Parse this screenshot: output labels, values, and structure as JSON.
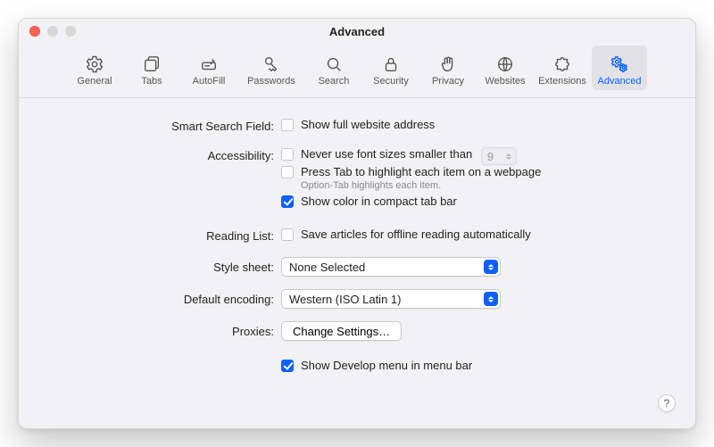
{
  "window": {
    "title": "Advanced"
  },
  "toolbar": {
    "items": [
      {
        "id": "general",
        "label": "General"
      },
      {
        "id": "tabs",
        "label": "Tabs"
      },
      {
        "id": "autofill",
        "label": "AutoFill"
      },
      {
        "id": "passwords",
        "label": "Passwords"
      },
      {
        "id": "search",
        "label": "Search"
      },
      {
        "id": "security",
        "label": "Security"
      },
      {
        "id": "privacy",
        "label": "Privacy"
      },
      {
        "id": "websites",
        "label": "Websites"
      },
      {
        "id": "extensions",
        "label": "Extensions"
      },
      {
        "id": "advanced",
        "label": "Advanced"
      }
    ],
    "selected": "advanced"
  },
  "sections": {
    "smart_search": {
      "label": "Smart Search Field:",
      "show_full_url": {
        "label": "Show full website address",
        "checked": false
      }
    },
    "accessibility": {
      "label": "Accessibility:",
      "min_font": {
        "label": "Never use font sizes smaller than",
        "checked": false,
        "value": "9"
      },
      "press_tab": {
        "label": "Press Tab to highlight each item on a webpage",
        "checked": false
      },
      "hint": "Option-Tab highlights each item.",
      "compact_color": {
        "label": "Show color in compact tab bar",
        "checked": true
      }
    },
    "reading_list": {
      "label": "Reading List:",
      "save_offline": {
        "label": "Save articles for offline reading automatically",
        "checked": false
      }
    },
    "style_sheet": {
      "label": "Style sheet:",
      "value": "None Selected"
    },
    "default_encoding": {
      "label": "Default encoding:",
      "value": "Western (ISO Latin 1)"
    },
    "proxies": {
      "label": "Proxies:",
      "button": "Change Settings…"
    },
    "develop": {
      "label": "Show Develop menu in menu bar",
      "checked": true
    }
  },
  "help_label": "?"
}
